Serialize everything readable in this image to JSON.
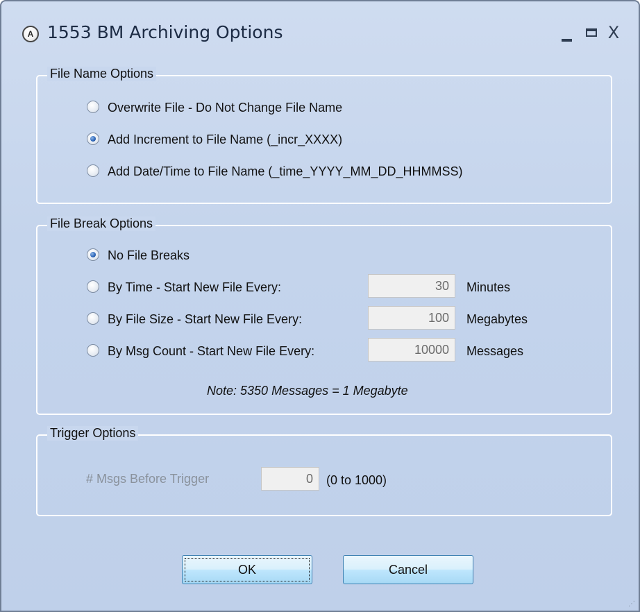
{
  "window": {
    "title": "1553 BM Archiving Options",
    "icon": "app-logo-icon",
    "controls": {
      "minimize": "minimize-icon",
      "maximize": "maximize-icon",
      "close_glyph": "X"
    }
  },
  "file_name_options": {
    "title": "File Name Options",
    "options": [
      {
        "label": "Overwrite File - Do Not Change File Name",
        "checked": false
      },
      {
        "label": "Add Increment to File Name (_incr_XXXX)",
        "checked": true
      },
      {
        "label": "Add Date/Time to File Name (_time_YYYY_MM_DD_HHMMSS)",
        "checked": false
      }
    ]
  },
  "file_break_options": {
    "title": "File Break Options",
    "options": [
      {
        "label": "No File Breaks",
        "checked": true
      },
      {
        "label": "By Time - Start New File Every:",
        "checked": false,
        "value": "30",
        "unit": "Minutes"
      },
      {
        "label": "By File Size - Start New File Every:",
        "checked": false,
        "value": "100",
        "unit": "Megabytes"
      },
      {
        "label": "By Msg Count - Start New File Every:",
        "checked": false,
        "value": "10000",
        "unit": "Messages"
      }
    ],
    "note": "Note:  5350 Messages = 1 Megabyte"
  },
  "trigger_options": {
    "title": "Trigger Options",
    "label": "# Msgs Before Trigger",
    "value": "0",
    "range": "(0 to 1000)"
  },
  "buttons": {
    "ok": "OK",
    "cancel": "Cancel"
  }
}
